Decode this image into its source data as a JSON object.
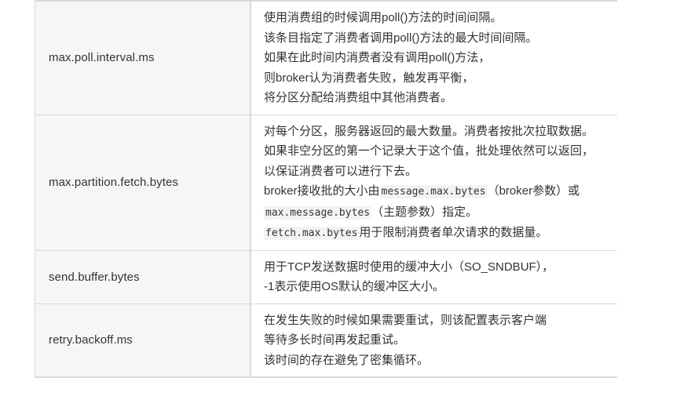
{
  "rows": [
    {
      "key": "max.poll.interval.ms",
      "lines": [
        [
          {
            "t": "使用消费组的时候调用poll()方法的时间间隔。"
          }
        ],
        [
          {
            "t": "该条目指定了消费者调用poll()方法的最大时间间隔。"
          }
        ],
        [
          {
            "t": "如果在此时间内消费者没有调用poll()方法，"
          }
        ],
        [
          {
            "t": "则broker认为消费者失败，触发再平衡，"
          }
        ],
        [
          {
            "t": "将分区分配给消费组中其他消费者。"
          }
        ]
      ]
    },
    {
      "key": "max.partition.fetch.bytes",
      "lines": [
        [
          {
            "t": "对每个分区，服务器返回的最大数量。消费者按批次拉取数据。"
          }
        ],
        [
          {
            "t": "如果非空分区的第一个记录大于这个值，批处理依然可以返回，"
          }
        ],
        [
          {
            "t": "以保证消费者可以进行下去。"
          }
        ],
        [
          {
            "t": "broker接收批的大小由"
          },
          {
            "code": "message.max.bytes"
          },
          {
            "t": "（broker参数）或"
          }
        ],
        [
          {
            "code": "max.message.bytes"
          },
          {
            "t": "（主题参数）指定。"
          }
        ],
        [
          {
            "code": "fetch.max.bytes"
          },
          {
            "t": "用于限制消费者单次请求的数据量。"
          }
        ]
      ]
    },
    {
      "key": "send.buffer.bytes",
      "lines": [
        [
          {
            "t": "用于TCP发送数据时使用的缓冲大小（SO_SNDBUF），"
          }
        ],
        [
          {
            "t": "-1表示使用OS默认的缓冲区大小。"
          }
        ]
      ]
    },
    {
      "key": "retry.backoff.ms",
      "lines": [
        [
          {
            "t": "在发生失败的时候如果需要重试，则该配置表示客户端"
          }
        ],
        [
          {
            "t": "等待多长时间再发起重试。"
          }
        ],
        [
          {
            "t": "该时间的存在避免了密集循环。"
          }
        ]
      ]
    }
  ]
}
